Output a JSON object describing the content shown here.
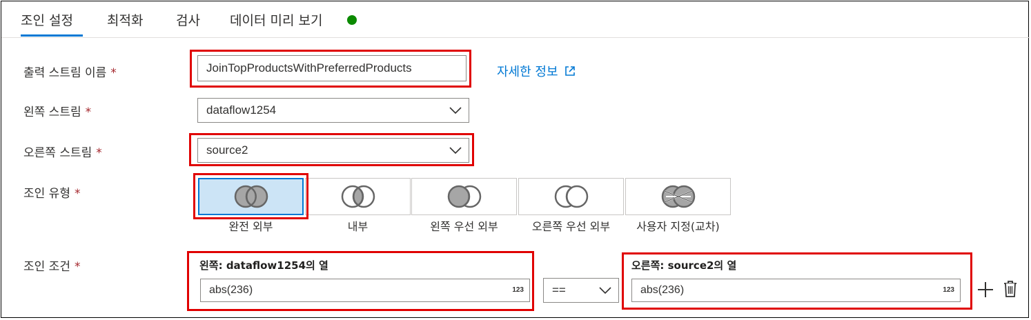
{
  "tabs": [
    {
      "label": "조인 설정",
      "active": true
    },
    {
      "label": "최적화"
    },
    {
      "label": "검사"
    },
    {
      "label": "데이터 미리 보기"
    }
  ],
  "status_color": "#0b8a00",
  "required_marker": "*",
  "output_stream": {
    "label": "출력 스트림 이름",
    "value": "JoinTopProductsWithPreferredProducts"
  },
  "learn_more": {
    "label": "자세한 정보",
    "icon": "external-link-icon"
  },
  "left_stream": {
    "label": "왼쪽 스트림",
    "value": "dataflow1254"
  },
  "right_stream": {
    "label": "오른쪽 스트림",
    "value": "source2"
  },
  "join_type": {
    "label": "조인 유형",
    "options": [
      {
        "label": "완전 외부",
        "selected": true
      },
      {
        "label": "내부"
      },
      {
        "label": "왼쪽 우선 외부"
      },
      {
        "label": "오른쪽 우선 외부"
      },
      {
        "label": "사용자 지정(교차)"
      }
    ]
  },
  "join_conditions": {
    "label": "조인 조건",
    "left_header": "왼쪽: dataflow1254의 열",
    "right_header": "오른쪽: source2의 열",
    "left_value": "abs(236)",
    "right_value": "abs(236)",
    "type_badge": "123",
    "operator": "=="
  },
  "highlight_color": "#e00000",
  "accent_color": "#0078d4"
}
